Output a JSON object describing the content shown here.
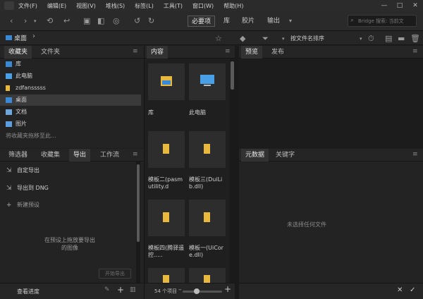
{
  "menu": [
    "文件(F)",
    "编辑(E)",
    "视图(V)",
    "堆栈(S)",
    "标签(L)",
    "工具(T)",
    "窗口(W)",
    "帮助(H)"
  ],
  "window_controls": [
    "—",
    "□",
    "✕"
  ],
  "workspaces": [
    "必要项",
    "库",
    "胶片",
    "输出"
  ],
  "search_placeholder": "Bridge 搜索: 当前文",
  "path": "桌面",
  "sort_label": "按文件名排序",
  "favorites_tabs": [
    "收藏夹",
    "文件夹"
  ],
  "favorites": [
    "库",
    "此电脑",
    "zdfansssss",
    "桌面",
    "文档",
    "图片"
  ],
  "favorites_hint": "将收藏夹拖移至此...",
  "bottom_tabs": [
    "筛选器",
    "收藏集",
    "导出",
    "工作流"
  ],
  "export_items": [
    "自定导出",
    "导出到 DNG",
    "新建预设"
  ],
  "export_hint": "在预设上拖放要导出的图像",
  "export_button": "开始导出",
  "queue_label": "查看进度",
  "content_tab": "内容",
  "content_items": [
    {
      "label": "库",
      "icon": "library-folder-icon"
    },
    {
      "label": "此电脑",
      "icon": "computer-icon"
    },
    {
      "label": "模板二(pasmutility.d",
      "icon": "folder-icon"
    },
    {
      "label": "模板三(DuiLib.dll)",
      "icon": "folder-icon"
    },
    {
      "label": "模板四(腾驿遥控.....",
      "icon": "folder-icon"
    },
    {
      "label": "模板一(UiCore.dll)",
      "icon": "folder-icon"
    },
    {
      "label": "",
      "icon": "folder-icon"
    },
    {
      "label": "",
      "icon": "folder-icon"
    }
  ],
  "item_count": "54 个项目",
  "preview_tabs": [
    "预览",
    "发布"
  ],
  "meta_tabs": [
    "元数据",
    "关键字"
  ],
  "meta_empty": "未选择任何文件",
  "colors": {
    "bg": "#1e1e1e",
    "panel": "#252525",
    "folder": "#e8b93c",
    "accent": "#3a89d6"
  }
}
